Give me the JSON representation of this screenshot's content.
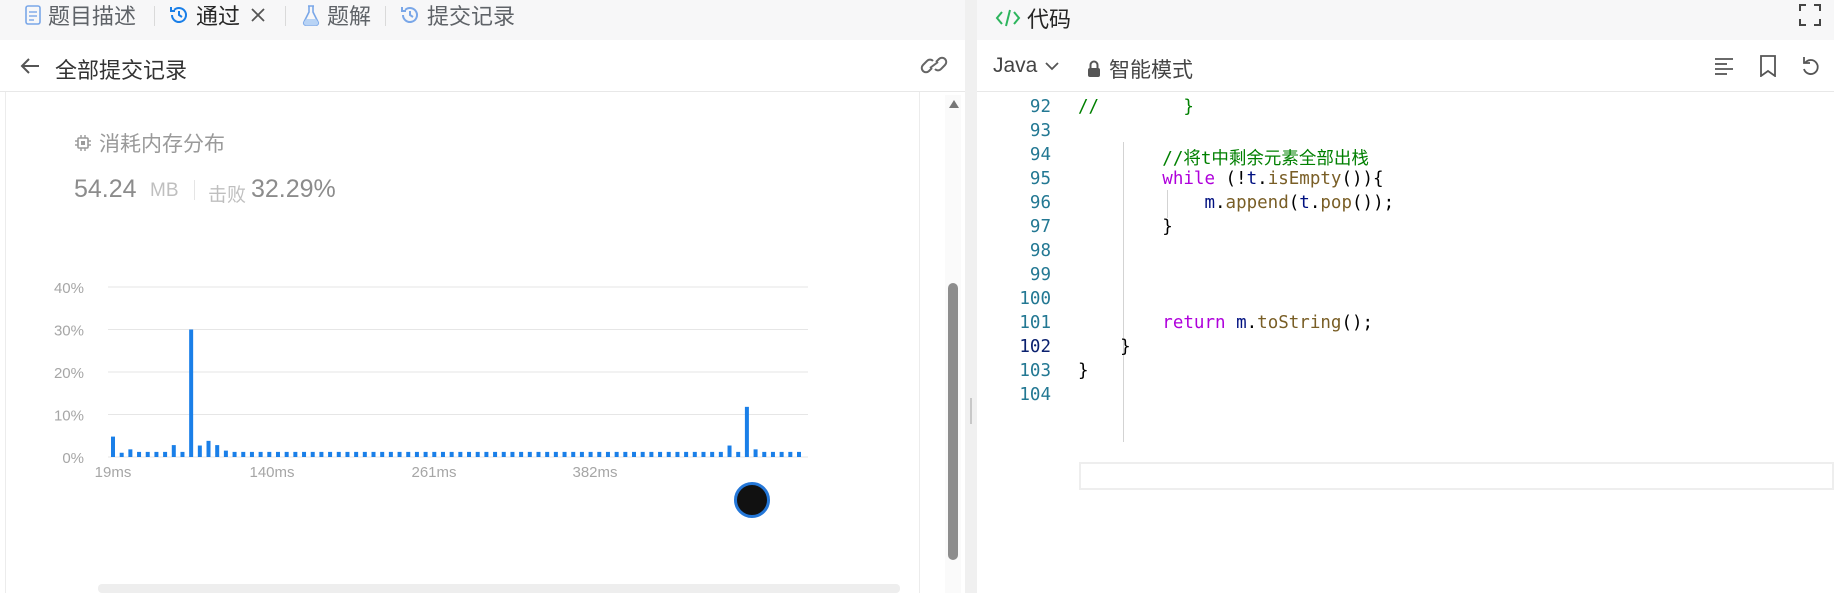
{
  "left_panel": {
    "tabs": [
      {
        "label": "题目描述",
        "icon": "document-icon"
      },
      {
        "label": "通过",
        "icon": "history-icon",
        "closable": true
      },
      {
        "label": "题解",
        "icon": "flask-icon"
      },
      {
        "label": "提交记录",
        "icon": "history-icon"
      }
    ],
    "subheader": {
      "title": "全部提交记录"
    },
    "memory": {
      "label": "消耗内存分布",
      "value": "54.24",
      "unit": "MB",
      "beat_label": "击败",
      "beat_value": "32.29%"
    }
  },
  "chart_data": {
    "type": "bar",
    "ylim": [
      0,
      40
    ],
    "y_ticks": [
      "40%",
      "30%",
      "20%",
      "10%",
      "0%"
    ],
    "x_ticks": [
      "19ms",
      "140ms",
      "261ms",
      "382ms"
    ],
    "bar_color": "#1a7fe8",
    "values": [
      4.8,
      1.0,
      1.8,
      1.2,
      1.2,
      1.2,
      1.2,
      2.8,
      1.2,
      30.0,
      2.7,
      3.8,
      2.8,
      1.5,
      1.2,
      1.2,
      1.2,
      1.2,
      1.2,
      1.2,
      1.2,
      1.2,
      1.2,
      1.2,
      1.2,
      1.2,
      1.2,
      1.2,
      1.2,
      1.2,
      1.2,
      1.2,
      1.2,
      1.2,
      1.2,
      1.2,
      1.2,
      1.2,
      1.2,
      1.2,
      1.2,
      1.2,
      1.2,
      1.2,
      1.2,
      1.2,
      1.2,
      1.2,
      1.2,
      1.2,
      1.2,
      1.2,
      1.2,
      1.2,
      1.2,
      1.2,
      1.2,
      1.2,
      1.2,
      1.2,
      1.2,
      1.2,
      1.2,
      1.2,
      1.2,
      1.2,
      1.2,
      1.2,
      1.2,
      1.2,
      1.2,
      2.7,
      1.2,
      11.8,
      1.8,
      1.2,
      1.2,
      1.2,
      1.2,
      1.2
    ]
  },
  "right_panel": {
    "title": "代码",
    "language": "Java",
    "mode": "智能模式",
    "current_line": "102",
    "lines": [
      {
        "n": "92",
        "tokens": [
          {
            "t": "//        }",
            "c": "cm"
          }
        ]
      },
      {
        "n": "93",
        "tokens": []
      },
      {
        "n": "94",
        "tokens": [
          {
            "t": "        ",
            "c": ""
          },
          {
            "t": "//将t中剩余元素全部出栈",
            "c": "cm"
          }
        ]
      },
      {
        "n": "95",
        "tokens": [
          {
            "t": "        ",
            "c": ""
          },
          {
            "t": "while",
            "c": "kw"
          },
          {
            "t": " (!",
            "c": ""
          },
          {
            "t": "t",
            "c": "id"
          },
          {
            "t": ".",
            "c": ""
          },
          {
            "t": "isEmpty",
            "c": "fn"
          },
          {
            "t": "()){",
            "c": ""
          }
        ]
      },
      {
        "n": "96",
        "tokens": [
          {
            "t": "            ",
            "c": ""
          },
          {
            "t": "m",
            "c": "id"
          },
          {
            "t": ".",
            "c": ""
          },
          {
            "t": "append",
            "c": "fn"
          },
          {
            "t": "(",
            "c": ""
          },
          {
            "t": "t",
            "c": "id"
          },
          {
            "t": ".",
            "c": ""
          },
          {
            "t": "pop",
            "c": "fn"
          },
          {
            "t": "());",
            "c": ""
          }
        ]
      },
      {
        "n": "97",
        "tokens": [
          {
            "t": "        }",
            "c": ""
          }
        ]
      },
      {
        "n": "98",
        "tokens": []
      },
      {
        "n": "99",
        "tokens": []
      },
      {
        "n": "100",
        "tokens": []
      },
      {
        "n": "101",
        "tokens": [
          {
            "t": "        ",
            "c": ""
          },
          {
            "t": "return",
            "c": "kw"
          },
          {
            "t": " ",
            "c": ""
          },
          {
            "t": "m",
            "c": "id"
          },
          {
            "t": ".",
            "c": ""
          },
          {
            "t": "toString",
            "c": "fn"
          },
          {
            "t": "();",
            "c": ""
          }
        ]
      },
      {
        "n": "102",
        "tokens": [
          {
            "t": "    }",
            "c": ""
          }
        ]
      },
      {
        "n": "103",
        "tokens": [
          {
            "t": "}",
            "c": ""
          }
        ]
      },
      {
        "n": "104",
        "tokens": []
      }
    ]
  },
  "colors": {
    "accent": "#1a7fe8",
    "code_keyword": "#af00db",
    "code_comment": "#008000",
    "line_number": "#237893"
  }
}
